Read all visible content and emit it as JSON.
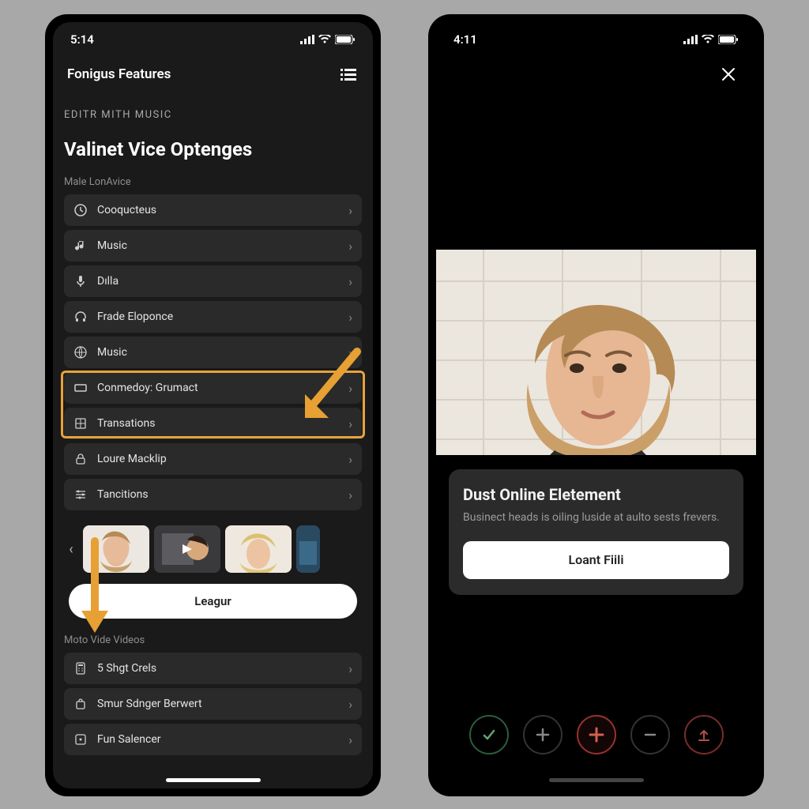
{
  "left": {
    "time": "5:14",
    "header_title": "Fonigus Features",
    "eyebrow": "EDITR MITH MUSIC",
    "title": "Valinet Vice Optenges",
    "section1_label": "Male LonAvice",
    "rows": [
      {
        "icon": "clock",
        "label": "Cooqucteus"
      },
      {
        "icon": "music-note",
        "label": "Music"
      },
      {
        "icon": "mic",
        "label": "Dılla"
      },
      {
        "icon": "headphones",
        "label": "Frade Eloponce"
      },
      {
        "icon": "globe",
        "label": "Music"
      },
      {
        "icon": "rect",
        "label": "Conmedoy: Grumact"
      },
      {
        "icon": "grid",
        "label": "Transations"
      },
      {
        "icon": "lock",
        "label": "Loure Macklip"
      },
      {
        "icon": "sliders",
        "label": "Tancitions"
      }
    ],
    "pill_label": "Leagur",
    "section2_label": "Moto Vide Videos",
    "rows2": [
      {
        "icon": "calc",
        "label": "5 Shgt Crels"
      },
      {
        "icon": "bag",
        "label": "Smur Sdnger Berwert"
      },
      {
        "icon": "square-dot",
        "label": "Fun Salencer"
      }
    ]
  },
  "right": {
    "time": "4:11",
    "sheet_title": "Dust Online Eletement",
    "sheet_body": "Businect heads is oiling luside at aulto sests frevers.",
    "cta_label": "Loant Fiili"
  }
}
